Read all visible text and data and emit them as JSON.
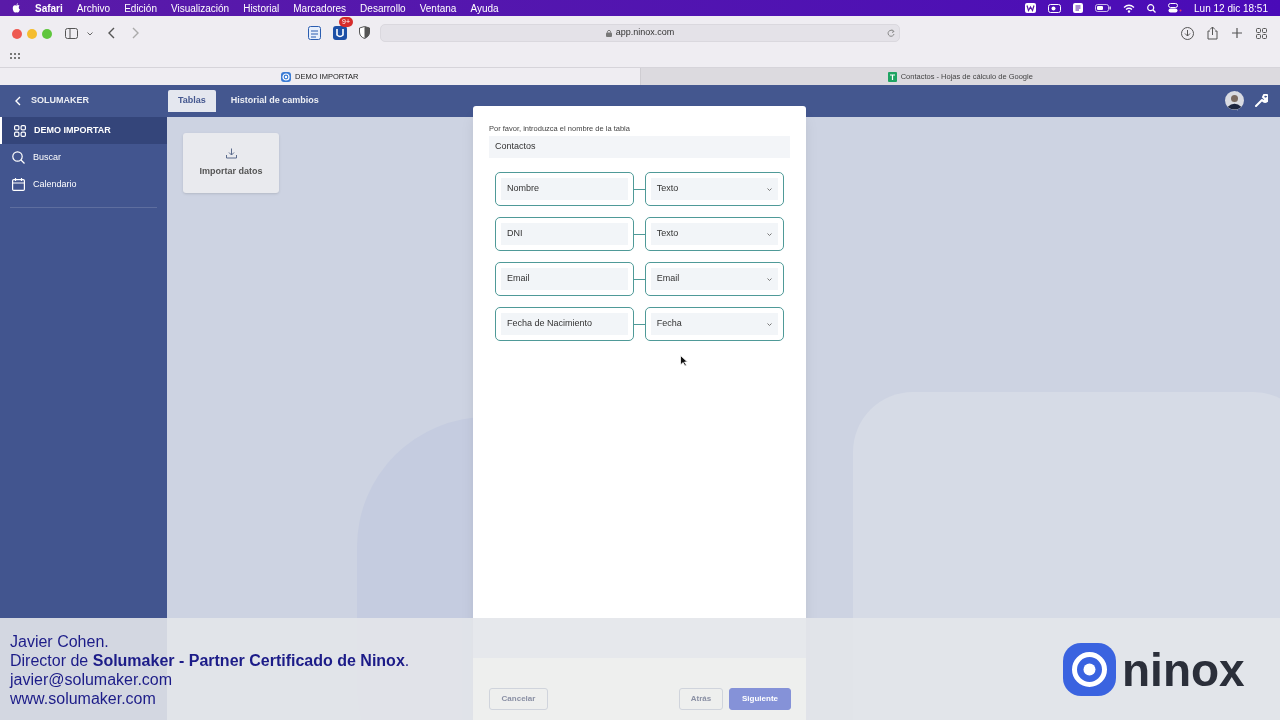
{
  "menu_bar": {
    "app": "Safari",
    "items": [
      "Archivo",
      "Edición",
      "Visualización",
      "Historial",
      "Marcadores",
      "Desarrollo",
      "Ventana",
      "Ayuda"
    ],
    "clock": "Lun 12 dic  18:51"
  },
  "browser": {
    "address": "app.ninox.com",
    "badge": "9+",
    "tabs": [
      {
        "title": "DEMO IMPORTAR",
        "kind": "ninox",
        "selected": true
      },
      {
        "title": "Contactos - Hojas de cálculo de Google",
        "kind": "sheets",
        "selected": false
      }
    ]
  },
  "app": {
    "back_label": "SOLUMAKER",
    "header_tabs": [
      {
        "label": "Tablas",
        "selected": true
      },
      {
        "label": "Historial de cambios",
        "selected": false
      }
    ],
    "sidebar": [
      {
        "label": "DEMO IMPORTAR",
        "kind": "grid",
        "selected": true
      },
      {
        "label": "Buscar",
        "kind": "search",
        "selected": false
      },
      {
        "label": "Calendario",
        "kind": "calendar",
        "selected": false
      }
    ],
    "import_card": {
      "label": "Importar datos"
    }
  },
  "dialog": {
    "prompt": "Por favor, introduzca el nombre de la tabla",
    "table_name": "Contactos",
    "fields": [
      {
        "name": "Nombre",
        "type": "Texto"
      },
      {
        "name": "DNI",
        "type": "Texto"
      },
      {
        "name": "Email",
        "type": "Email"
      },
      {
        "name": "Fecha de Nacimiento",
        "type": "Fecha"
      }
    ],
    "buttons": [
      {
        "label": "Cancelar",
        "kind": "outline"
      },
      {
        "label": "Atrás",
        "kind": "outline"
      },
      {
        "label": "Siguiente",
        "kind": "primary"
      }
    ]
  },
  "caption": {
    "lines": [
      "Javier Cohen.",
      "Director de **Solumaker - Partner Certificado de Ninox**.",
      "javier@solumaker.com",
      "www.solumaker.com"
    ],
    "logo_text": "ninox"
  }
}
